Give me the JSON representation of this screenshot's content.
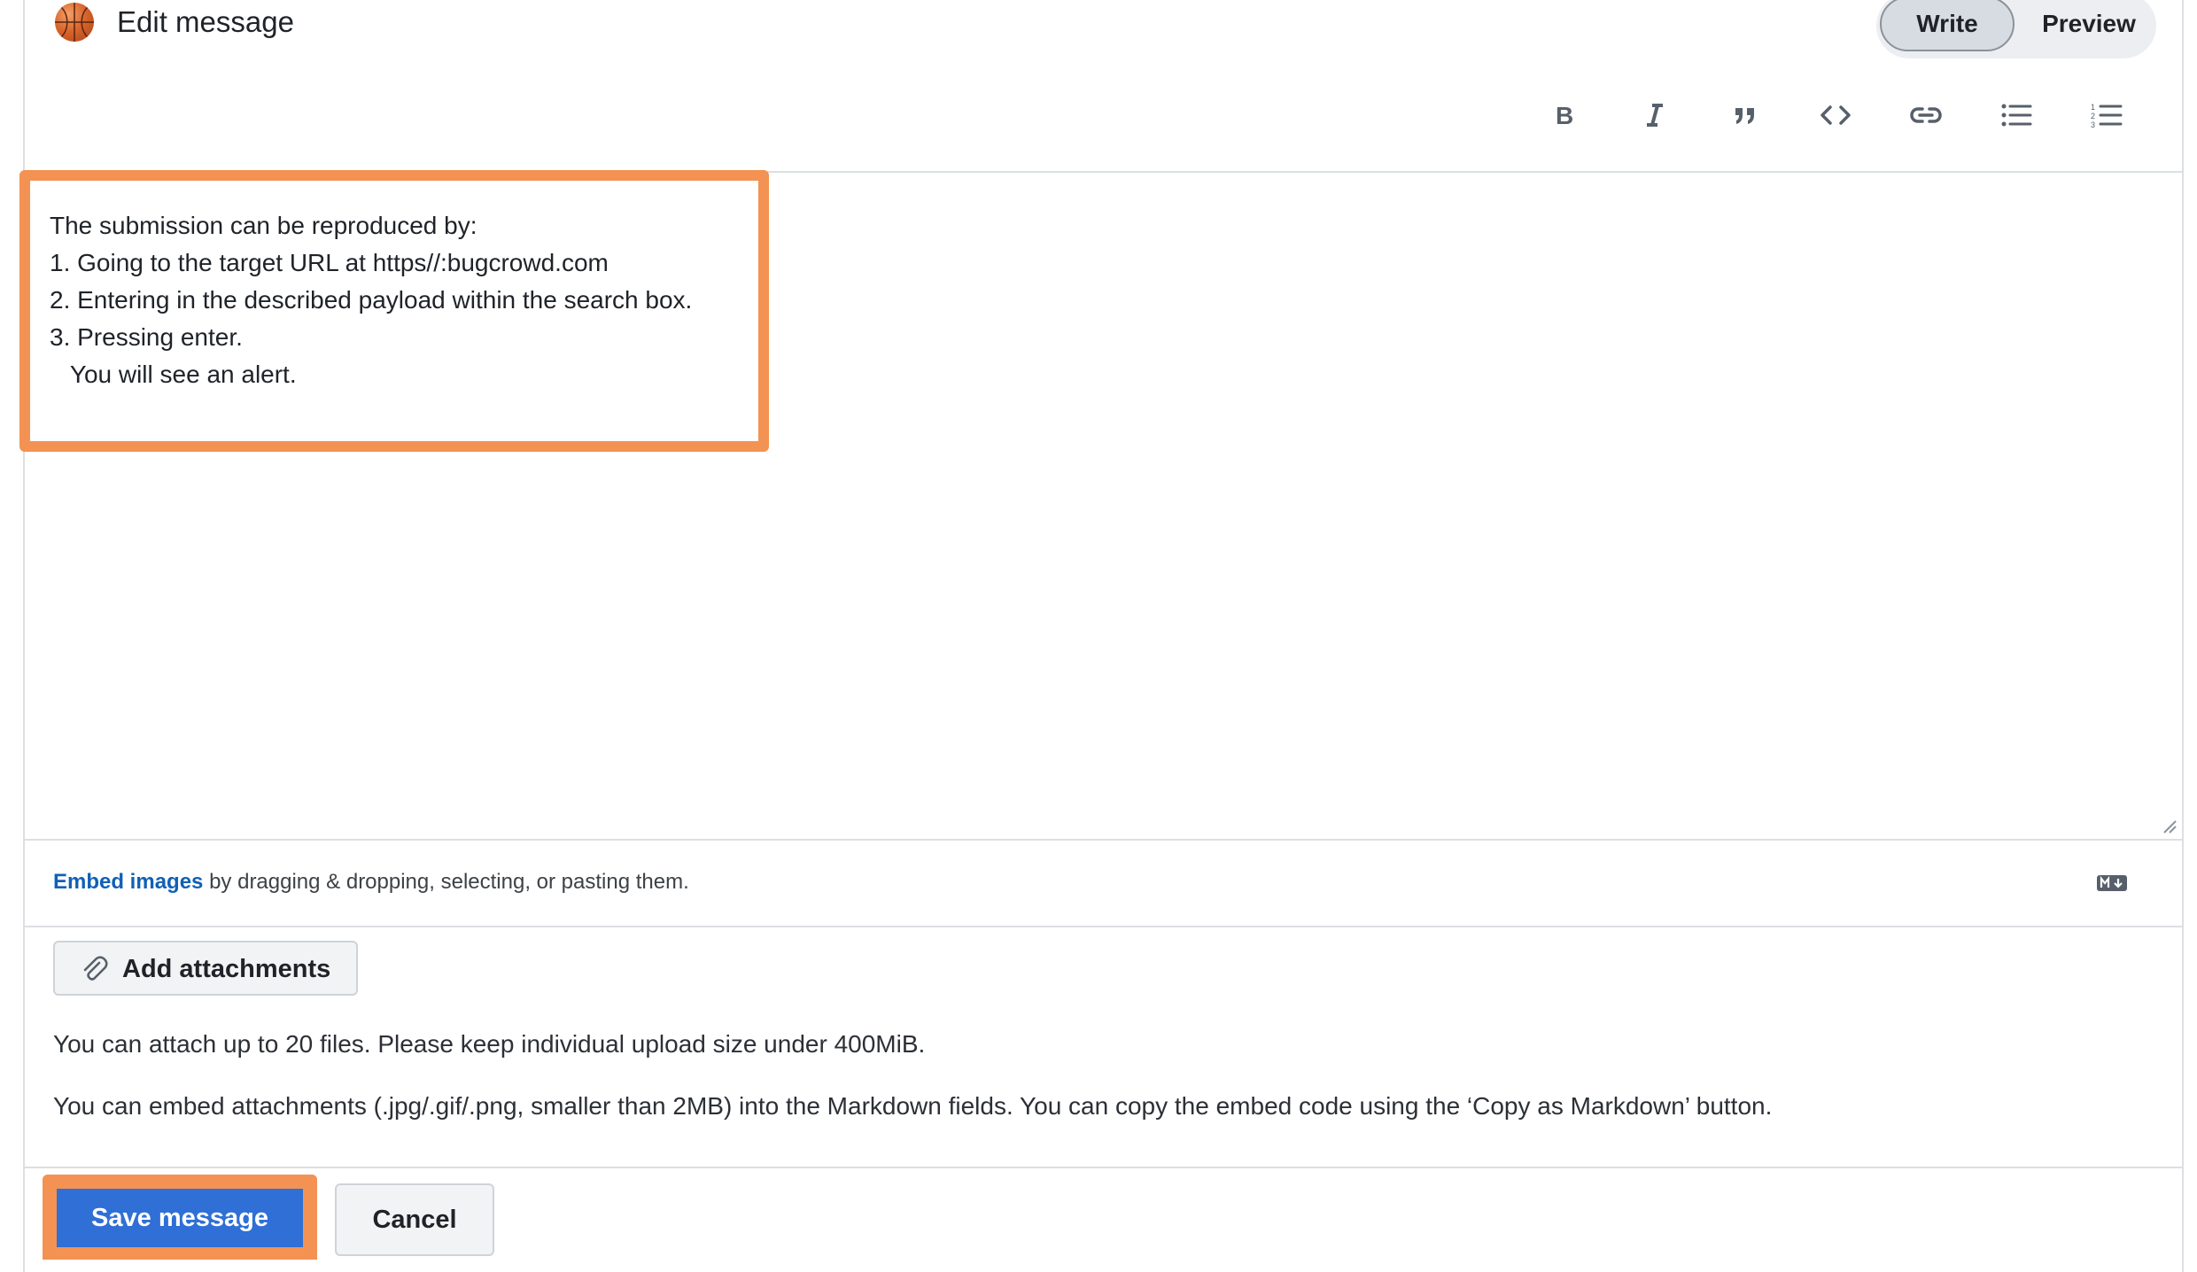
{
  "header": {
    "title": "Edit message",
    "avatar_icon": "basketball-avatar"
  },
  "mode_toggle": {
    "write_label": "Write",
    "preview_label": "Preview",
    "selected": "Write"
  },
  "toolbar": {
    "buttons": [
      "bold-icon",
      "italic-icon",
      "quote-icon",
      "code-icon",
      "link-icon",
      "bulleted-list-icon",
      "numbered-list-icon"
    ]
  },
  "editor": {
    "lines": [
      "The submission can be reproduced by:",
      "1. Going to the target URL at https//:bugcrowd.com",
      "2. Entering in the described payload within the search box.",
      "3. Pressing enter.",
      "   You will see an alert."
    ]
  },
  "embed_hint": {
    "link": "Embed images",
    "text": " by dragging & dropping, selecting, or pasting them."
  },
  "attachments": {
    "button_label": "Add attachments",
    "limit_text": "You can attach up to 20 files. Please keep individual upload size under 400MiB.",
    "embed_text": "You can embed attachments (.jpg/.gif/.png, smaller than 2MB) into the Markdown fields. You can copy the embed code using the ‘Copy as Markdown’ button."
  },
  "actions": {
    "save_label": "Save message",
    "cancel_label": "Cancel"
  },
  "colors": {
    "highlight": "#f39252",
    "primary_button": "#2f6fd6",
    "link": "#1060b6"
  }
}
